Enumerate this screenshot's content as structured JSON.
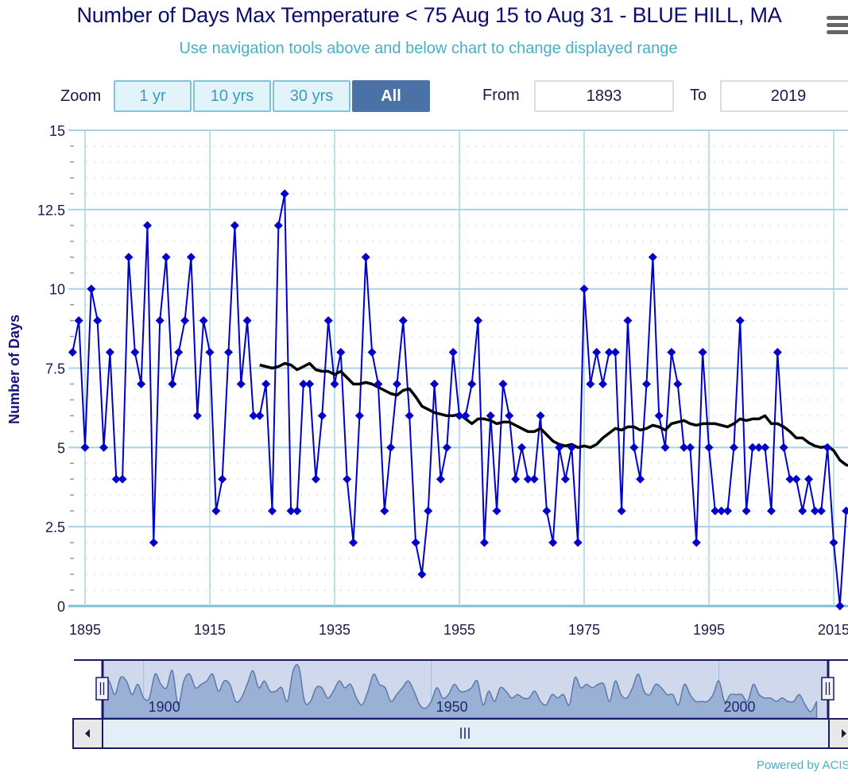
{
  "header": {
    "title": "Number of Days Max Temperature < 75 Aug 15 to Aug 31 - BLUE HILL, MA",
    "subtitle": "Use navigation tools above and below chart to change displayed range",
    "menu_icon": "hamburger-menu-icon"
  },
  "range_selector": {
    "zoom_label": "Zoom",
    "buttons": [
      {
        "label": "1 yr",
        "active": false
      },
      {
        "label": "10 yrs",
        "active": false
      },
      {
        "label": "30 yrs",
        "active": false
      },
      {
        "label": "All",
        "active": true
      }
    ],
    "from_label": "From",
    "from_value": "1893",
    "to_label": "To",
    "to_value": "2019"
  },
  "navigator": {
    "labels": [
      "1900",
      "1950",
      "2000"
    ],
    "left_arrow_icon": "arrow-left-icon",
    "right_arrow_icon": "arrow-right-icon",
    "scrollbar_grip_icon": "grip-icon",
    "handle_icon": "drag-handle-icon"
  },
  "footer": {
    "credit": "Powered by ACIS"
  },
  "colors": {
    "series": "#0000cc",
    "moving_average": "#000000",
    "grid": "#a9d3e3",
    "title": "#0c0c6e",
    "subtitle": "#45b0c8",
    "active_button": "#4a72a6",
    "navigator_fill": "#9ab0d4"
  },
  "chart_data": {
    "type": "line",
    "title": "Number of Days Max Temperature < 75 Aug 15 to Aug 31 - BLUE HILL, MA",
    "xlabel": "",
    "ylabel": "Number of Days",
    "xlim": [
      1893,
      2017.3
    ],
    "ylim": [
      0,
      15
    ],
    "x_ticks": [
      1895,
      1915,
      1935,
      1955,
      1975,
      1995,
      2015
    ],
    "y_ticks": [
      0,
      2.5,
      5,
      7.5,
      10,
      12.5,
      15
    ],
    "y_tick_labels": [
      "0",
      "2.5",
      "5",
      "7.5",
      "10",
      "12.5",
      "15"
    ],
    "grid": true,
    "series": [
      {
        "name": "Number of Days",
        "marker": "diamond",
        "x": [
          1893,
          1894,
          1895,
          1896,
          1897,
          1898,
          1899,
          1900,
          1901,
          1902,
          1903,
          1904,
          1905,
          1906,
          1907,
          1908,
          1909,
          1910,
          1911,
          1912,
          1913,
          1914,
          1915,
          1916,
          1917,
          1918,
          1919,
          1920,
          1921,
          1922,
          1923,
          1924,
          1925,
          1926,
          1927,
          1928,
          1929,
          1930,
          1931,
          1932,
          1933,
          1934,
          1935,
          1936,
          1937,
          1938,
          1939,
          1940,
          1941,
          1942,
          1943,
          1944,
          1945,
          1946,
          1947,
          1948,
          1949,
          1950,
          1951,
          1952,
          1953,
          1954,
          1955,
          1956,
          1957,
          1958,
          1959,
          1960,
          1961,
          1962,
          1963,
          1964,
          1965,
          1966,
          1967,
          1968,
          1969,
          1970,
          1971,
          1972,
          1973,
          1974,
          1975,
          1976,
          1977,
          1978,
          1979,
          1980,
          1981,
          1982,
          1983,
          1984,
          1985,
          1986,
          1987,
          1988,
          1989,
          1990,
          1991,
          1992,
          1993,
          1994,
          1995,
          1996,
          1997,
          1998,
          1999,
          2000,
          2001,
          2002,
          2003,
          2004,
          2005,
          2006,
          2007,
          2008,
          2009,
          2010,
          2011,
          2012,
          2013,
          2014,
          2015,
          2016,
          2017
        ],
        "values": [
          8,
          9,
          5,
          10,
          9,
          5,
          8,
          4,
          4,
          11,
          8,
          7,
          12,
          2,
          9,
          11,
          7,
          8,
          9,
          11,
          6,
          9,
          8,
          3,
          4,
          8,
          12,
          7,
          9,
          6,
          6,
          7,
          3,
          12,
          13,
          3,
          3,
          7,
          7,
          4,
          6,
          9,
          7,
          8,
          4,
          2,
          6,
          11,
          8,
          7,
          3,
          5,
          7,
          9,
          6,
          2,
          1,
          3,
          7,
          4,
          5,
          8,
          6,
          6,
          7,
          9,
          2,
          6,
          3,
          7,
          6,
          4,
          5,
          4,
          4,
          6,
          3,
          2,
          5,
          4,
          5,
          2,
          10,
          7,
          8,
          7,
          8,
          8,
          3,
          9,
          5,
          4,
          7,
          11,
          6,
          5,
          8,
          7,
          5,
          5,
          2,
          8,
          5,
          3,
          3,
          3,
          5,
          9,
          3,
          5,
          5,
          5,
          3,
          8,
          5,
          4,
          4,
          3,
          4,
          3,
          3,
          5,
          2,
          0,
          3
        ]
      },
      {
        "name": "Moving Average",
        "marker": "none",
        "x": [
          1923,
          1924,
          1925,
          1926,
          1927,
          1928,
          1929,
          1930,
          1931,
          1932,
          1933,
          1934,
          1935,
          1936,
          1937,
          1938,
          1939,
          1940,
          1941,
          1942,
          1943,
          1944,
          1945,
          1946,
          1947,
          1948,
          1949,
          1950,
          1951,
          1952,
          1953,
          1954,
          1955,
          1956,
          1957,
          1958,
          1959,
          1960,
          1961,
          1962,
          1963,
          1964,
          1965,
          1966,
          1967,
          1968,
          1969,
          1970,
          1971,
          1972,
          1973,
          1974,
          1975,
          1976,
          1977,
          1978,
          1979,
          1980,
          1981,
          1982,
          1983,
          1984,
          1985,
          1986,
          1987,
          1988,
          1989,
          1990,
          1991,
          1992,
          1993,
          1994,
          1995,
          1996,
          1997,
          1998,
          1999,
          2000,
          2001,
          2002,
          2003,
          2004,
          2005,
          2006,
          2007,
          2008,
          2009,
          2010,
          2011,
          2012,
          2013,
          2014,
          2015,
          2016,
          2017,
          2018
        ],
        "values": [
          7.6,
          7.55,
          7.5,
          7.55,
          7.65,
          7.6,
          7.45,
          7.55,
          7.65,
          7.45,
          7.4,
          7.4,
          7.3,
          7.4,
          7.2,
          7.0,
          7.0,
          7.05,
          7.0,
          6.9,
          6.8,
          6.7,
          6.65,
          6.8,
          6.85,
          6.6,
          6.3,
          6.2,
          6.1,
          6.05,
          6.0,
          6.0,
          6.05,
          5.9,
          5.75,
          5.9,
          5.9,
          5.85,
          5.75,
          5.8,
          5.8,
          5.7,
          5.6,
          5.5,
          5.5,
          5.6,
          5.4,
          5.2,
          5.1,
          5.05,
          5.1,
          5.0,
          5.05,
          5.0,
          5.1,
          5.3,
          5.45,
          5.6,
          5.55,
          5.65,
          5.65,
          5.55,
          5.6,
          5.7,
          5.65,
          5.55,
          5.75,
          5.8,
          5.85,
          5.75,
          5.7,
          5.75,
          5.75,
          5.75,
          5.7,
          5.65,
          5.75,
          5.9,
          5.85,
          5.9,
          5.9,
          6.0,
          5.75,
          5.75,
          5.65,
          5.5,
          5.3,
          5.3,
          5.15,
          5.05,
          5.0,
          5.05,
          4.9,
          4.6,
          4.45,
          4.4
        ]
      }
    ],
    "navigator": {
      "range": [
        1893,
        2019
      ],
      "selected": [
        1893,
        2019
      ],
      "x_labels": [
        1900,
        1950,
        2000
      ]
    },
    "legend": "none"
  }
}
